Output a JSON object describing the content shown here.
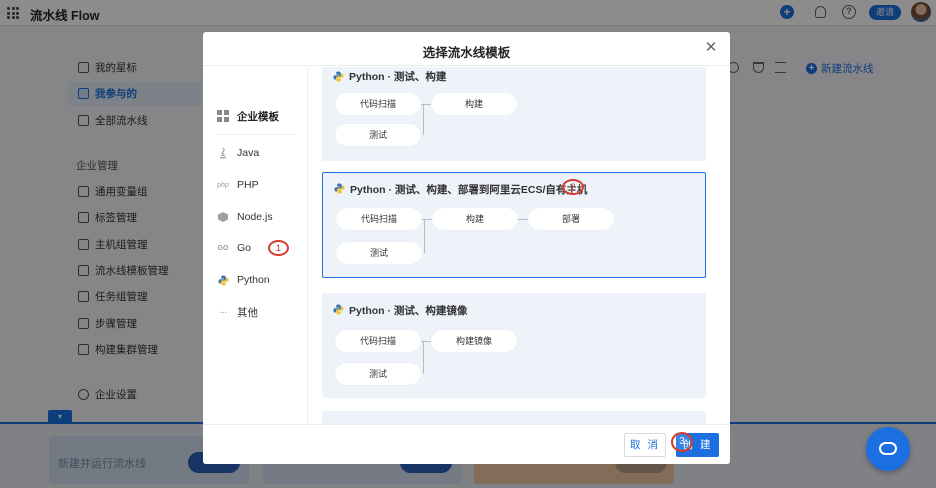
{
  "app": {
    "title": "流水线 Flow",
    "invite_label": "邀请",
    "new_pipeline_label": "新建流水线"
  },
  "sidebar": {
    "items": [
      {
        "label": "我的星标"
      },
      {
        "label": "我参与的",
        "active": true
      },
      {
        "label": "全部流水线"
      }
    ],
    "group_title": "企业管理",
    "group_items": [
      {
        "label": "通用变量组"
      },
      {
        "label": "标签管理"
      },
      {
        "label": "主机组管理"
      },
      {
        "label": "流水线模板管理"
      },
      {
        "label": "任务组管理"
      },
      {
        "label": "步骤管理"
      },
      {
        "label": "构建集群管理"
      }
    ],
    "settings_label": "企业设置"
  },
  "bottom_bar": {
    "card1_text": "新建并运行流水线"
  },
  "modal": {
    "title": "选择流水线模板",
    "categories": [
      {
        "label": "企业模板",
        "icon": "grid-icon"
      },
      {
        "label": "Java",
        "icon": "java-icon"
      },
      {
        "label": "PHP",
        "icon": "php-icon",
        "icon_text": "php"
      },
      {
        "label": "Node.js",
        "icon": "nodejs-icon"
      },
      {
        "label": "Go",
        "icon": "go-icon",
        "icon_text": "GO"
      },
      {
        "label": "Python",
        "icon": "python-icon",
        "selected": true
      },
      {
        "label": "其他",
        "icon": "more-icon",
        "icon_text": "···"
      }
    ],
    "templates": [
      {
        "title": "Python · 测试、构建",
        "stages": [
          "代码扫描",
          "测试",
          "构建"
        ]
      },
      {
        "title": "Python · 测试、构建、部署到阿里云ECS/自有主机",
        "stages": [
          "代码扫描",
          "测试",
          "构建",
          "部署"
        ],
        "selected": true
      },
      {
        "title": "Python · 测试、构建镜像",
        "stages": [
          "代码扫描",
          "测试",
          "构建镜像"
        ]
      }
    ],
    "cancel_label": "取 消",
    "create_label": "创 建"
  },
  "annotations": [
    "1",
    "2",
    "3"
  ],
  "colors": {
    "primary": "#1b6fe0",
    "annotation": "#d43b2d",
    "card_bg": "#eef3fa"
  }
}
